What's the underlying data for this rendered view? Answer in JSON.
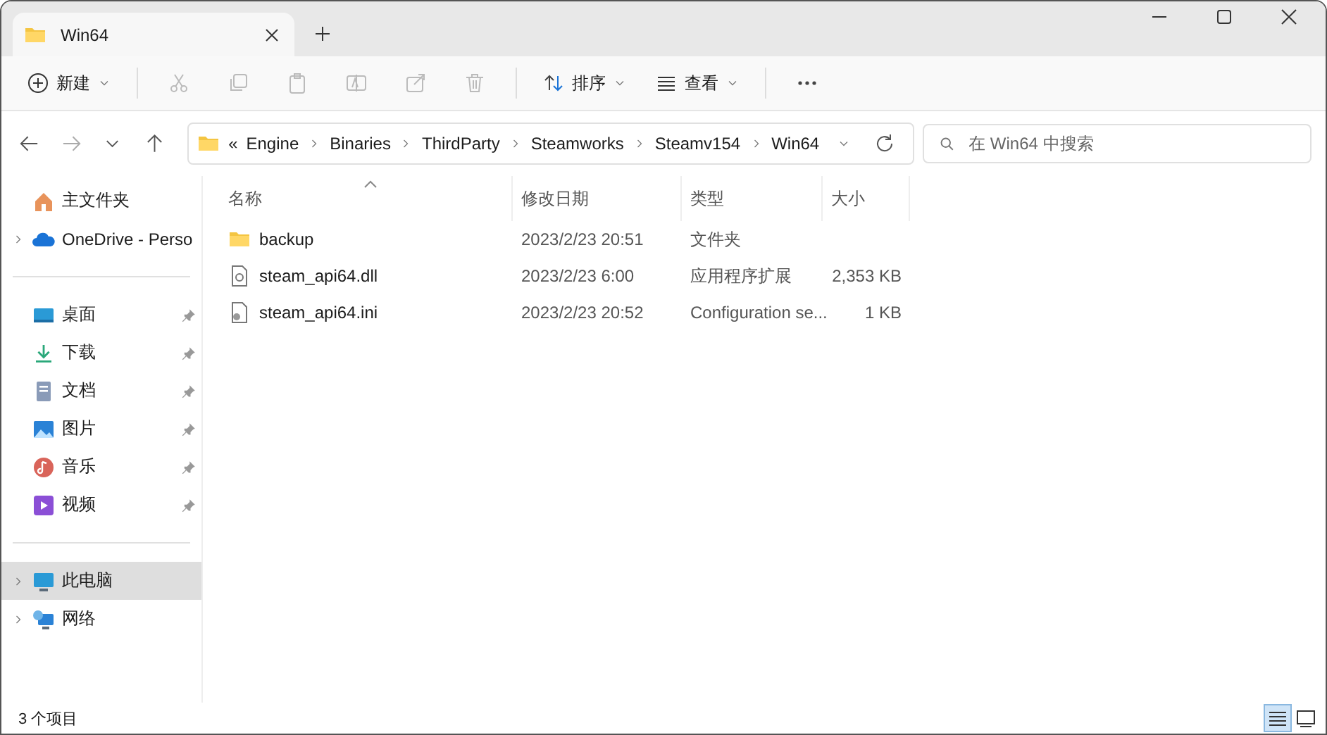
{
  "window": {
    "tab_title": "Win64"
  },
  "toolbar": {
    "new_label": "新建",
    "actions": [
      {
        "kind": "cut",
        "disabled": true
      },
      {
        "kind": "copy",
        "disabled": true
      },
      {
        "kind": "paste",
        "disabled": true
      },
      {
        "kind": "rename",
        "disabled": true
      },
      {
        "kind": "share",
        "disabled": true
      },
      {
        "kind": "delete",
        "disabled": true
      }
    ],
    "sort_label": "排序",
    "view_label": "查看"
  },
  "address": {
    "overflow": "«",
    "crumbs": [
      "Engine",
      "Binaries",
      "ThirdParty",
      "Steamworks",
      "Steamv154",
      "Win64"
    ]
  },
  "search": {
    "placeholder": "在 Win64 中搜索"
  },
  "sidebar": {
    "groups": [
      [
        {
          "label": "主文件夹",
          "expandable": false,
          "pinned": false,
          "selected": false
        },
        {
          "label": "OneDrive - Perso",
          "expandable": true,
          "pinned": false,
          "selected": false
        }
      ],
      [
        {
          "label": "桌面",
          "expandable": false,
          "pinned": true,
          "selected": false
        },
        {
          "label": "下载",
          "expandable": false,
          "pinned": true,
          "selected": false
        },
        {
          "label": "文档",
          "expandable": false,
          "pinned": true,
          "selected": false
        },
        {
          "label": "图片",
          "expandable": false,
          "pinned": true,
          "selected": false
        },
        {
          "label": "音乐",
          "expandable": false,
          "pinned": true,
          "selected": false
        },
        {
          "label": "视频",
          "expandable": false,
          "pinned": true,
          "selected": false
        }
      ],
      [
        {
          "label": "此电脑",
          "expandable": true,
          "pinned": false,
          "selected": true
        },
        {
          "label": "网络",
          "expandable": true,
          "pinned": false,
          "selected": false
        }
      ]
    ]
  },
  "table": {
    "columns": [
      {
        "label": "名称",
        "sorted": true
      },
      {
        "label": "修改日期",
        "sorted": false
      },
      {
        "label": "类型",
        "sorted": false
      },
      {
        "label": "大小",
        "sorted": false
      }
    ],
    "rows": [
      {
        "kind": "folder",
        "name": "backup",
        "date": "2023/2/23 20:51",
        "type": "文件夹"
      },
      {
        "kind": "dll",
        "name": "steam_api64.dll",
        "date": "2023/2/23 6:00",
        "type": "应用程序扩展",
        "size": "2,353 KB"
      },
      {
        "kind": "ini",
        "name": "steam_api64.ini",
        "date": "2023/2/23 20:52",
        "type": "Configuration se...",
        "size": "1 KB"
      }
    ]
  },
  "status_bar": {
    "count": "3 个项目",
    "views": [
      {
        "kind": "details",
        "selected": true
      },
      {
        "kind": "preview",
        "selected": false
      }
    ]
  }
}
